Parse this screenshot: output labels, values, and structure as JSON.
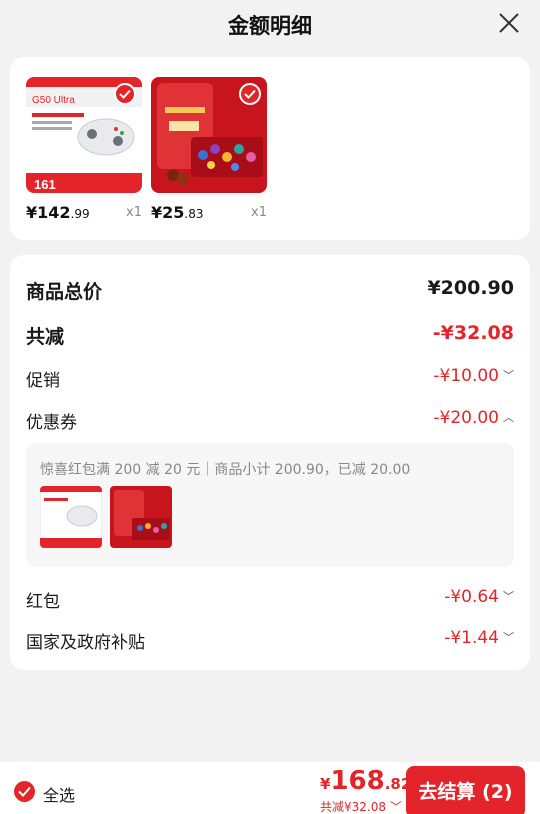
{
  "header": {
    "title": "金额明细"
  },
  "products": [
    {
      "price_int": "¥142",
      "price_dec": ".99",
      "qty": "x1",
      "thumb_badge": "161",
      "thumb_title": "G50 Ultra"
    },
    {
      "price_int": "¥25",
      "price_dec": ".83",
      "qty": "x1"
    }
  ],
  "summary": {
    "total_label": "商品总价",
    "total_value": "¥200.90",
    "discount_label": "共减",
    "discount_value": "-¥32.08",
    "promo_label": "促销",
    "promo_value": "-¥10.00",
    "coupon_label": "优惠券",
    "coupon_value": "-¥20.00",
    "coupon_desc": "惊喜红包满 200 减 20 元｜商品小计 200.90，已减 20.00",
    "redpacket_label": "红包",
    "redpacket_value": "-¥0.64",
    "subsidy_label": "国家及政府补贴",
    "subsidy_value": "-¥1.44"
  },
  "bottom": {
    "select_all": "全选",
    "total_yen": "¥",
    "total_int": "168",
    "total_dec": ".82",
    "saved": "共减¥32.08",
    "checkout": "去结算 (2)"
  },
  "colors": {
    "accent": "#e3252b",
    "background": "#f2f2f2"
  }
}
